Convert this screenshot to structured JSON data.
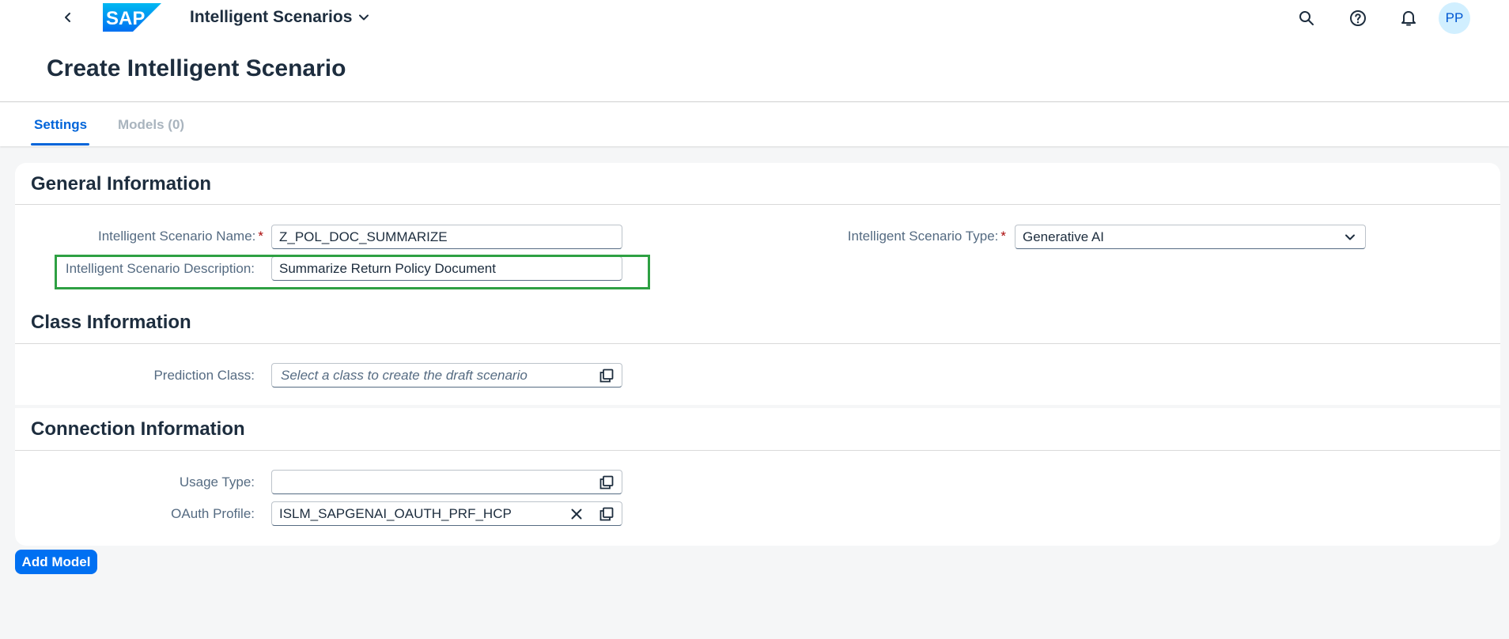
{
  "shell": {
    "app_title": "Intelligent Scenarios",
    "logo_text": "SAP",
    "user_initials": "PP",
    "brand_color": "#0070f2"
  },
  "page": {
    "title": "Create Intelligent Scenario"
  },
  "tabs": [
    {
      "label": "Settings",
      "selected": true
    },
    {
      "label": "Models (0)",
      "selected": false
    }
  ],
  "general": {
    "title": "General Information",
    "name_label": "Intelligent Scenario Name:",
    "name_value": "Z_POL_DOC_SUMMARIZE",
    "description_label": "Intelligent Scenario Description:",
    "description_value": "Summarize Return Policy Document",
    "type_label": "Intelligent Scenario Type:",
    "type_value": "Generative AI"
  },
  "class_info": {
    "title": "Class Information",
    "prediction_label": "Prediction Class:",
    "prediction_placeholder": "Select a class to create the draft scenario"
  },
  "connection": {
    "title": "Connection Information",
    "usage_label": "Usage Type:",
    "usage_value": "",
    "oauth_label": "OAuth Profile:",
    "oauth_value": "ISLM_SAPGENAI_OAUTH_PRF_HCP"
  },
  "actions": {
    "add_model": "Add Model"
  }
}
